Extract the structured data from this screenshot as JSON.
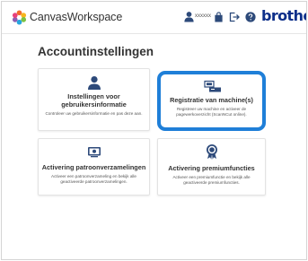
{
  "header": {
    "app_title": "CanvasWorkspace",
    "user_name": "xxxxxx",
    "brand": "brother"
  },
  "page": {
    "title": "Accountinstellingen"
  },
  "cards": [
    {
      "title": "Instellingen voor gebruikersinformatie",
      "description": "Controleer uw gebruikersinformatie en pas deze aan.",
      "icon": "user-icon"
    },
    {
      "title": "Registratie van machine(s)",
      "description": "Registreer uw machine en activeer de pagewerkoverzicht (ScanNCut online).",
      "icon": "machine-icon"
    },
    {
      "title": "Activering patroonverzamelingen",
      "description": "Activeer een patroonverzameling en bekijk alle geactiveerde patroonverzamelingen.",
      "icon": "pattern-collection-icon"
    },
    {
      "title": "Activering premiumfuncties",
      "description": "Activeer een premiumfunctie en bekijk alle geactiveerde premiumfuncties.",
      "icon": "premium-badge-icon"
    }
  ],
  "colors": {
    "highlight": "#1f7fd8",
    "brand": "#0d2f8a",
    "icon": "#2d4a7a"
  }
}
